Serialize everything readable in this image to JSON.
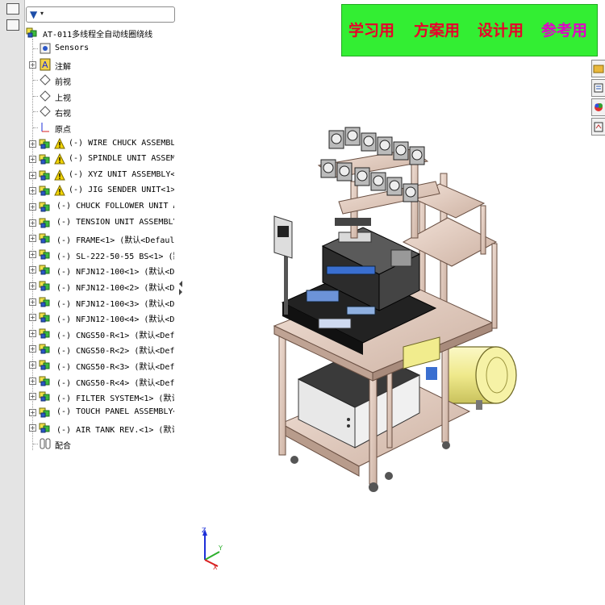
{
  "filter": {
    "icon": "filter-icon"
  },
  "tree": {
    "root": "AT-011多线程全自动线圈绕线",
    "items": [
      {
        "label": "Sensors",
        "icon": "sensors-icon",
        "expandable": false
      },
      {
        "label": "注解",
        "icon": "annotations-icon",
        "expandable": true
      },
      {
        "label": "前视",
        "icon": "plane-icon",
        "expandable": false
      },
      {
        "label": "上视",
        "icon": "plane-icon",
        "expandable": false
      },
      {
        "label": "右视",
        "icon": "plane-icon",
        "expandable": false
      },
      {
        "label": "原点",
        "icon": "origin-icon",
        "expandable": false
      },
      {
        "label": "(-) WIRE CHUCK ASSEMBLY",
        "icon": "assembly-warning-icon",
        "expandable": true
      },
      {
        "label": "(-) SPINDLE UNIT ASSEMB",
        "icon": "assembly-warning-icon",
        "expandable": true
      },
      {
        "label": "(-) XYZ  UNIT ASSEMBLY<",
        "icon": "assembly-warning-icon",
        "expandable": true
      },
      {
        "label": "(-) JIG SENDER UNIT<1>",
        "icon": "assembly-warning-icon",
        "expandable": true
      },
      {
        "label": "(-) CHUCK FOLLOWER UNIT AS",
        "icon": "assembly-icon",
        "expandable": true
      },
      {
        "label": "(-) TENSION UNIT ASSEMBLY",
        "icon": "assembly-icon",
        "expandable": true
      },
      {
        "label": "(-) FRAME<1> (默认<Defaul",
        "icon": "assembly-icon",
        "expandable": true
      },
      {
        "label": "(-) SL-222-50-55 BS<1> (默",
        "icon": "assembly-icon",
        "expandable": true
      },
      {
        "label": "(-) NFJN12-100<1> (默认<D",
        "icon": "assembly-icon",
        "expandable": true
      },
      {
        "label": "(-) NFJN12-100<2> (默认<D",
        "icon": "assembly-icon",
        "expandable": true
      },
      {
        "label": "(-) NFJN12-100<3> (默认<D",
        "icon": "assembly-icon",
        "expandable": true
      },
      {
        "label": "(-) NFJN12-100<4> (默认<D",
        "icon": "assembly-icon",
        "expandable": true
      },
      {
        "label": "(-) CNGS50-R<1> (默认<Def",
        "icon": "assembly-icon",
        "expandable": true
      },
      {
        "label": "(-) CNGS50-R<2> (默认<Def",
        "icon": "assembly-icon",
        "expandable": true
      },
      {
        "label": "(-) CNGS50-R<3> (默认<Def",
        "icon": "assembly-icon",
        "expandable": true
      },
      {
        "label": "(-) CNGS50-R<4> (默认<Def",
        "icon": "assembly-icon",
        "expandable": true
      },
      {
        "label": "(-) FILTER SYSTEM<1> (默认",
        "icon": "assembly-icon",
        "expandable": true
      },
      {
        "label": "(-) TOUCH PANEL ASSEMBLY<",
        "icon": "assembly-icon",
        "expandable": true
      },
      {
        "label": "(-) AIR TANK REV.<1> (默认",
        "icon": "assembly-icon",
        "expandable": true
      },
      {
        "label": "配合",
        "icon": "mates-icon",
        "expandable": false
      }
    ]
  },
  "banner": {
    "items": [
      {
        "text": "学习用",
        "color": "#e8002a"
      },
      {
        "text": "方案用",
        "color": "#e8002a"
      },
      {
        "text": "设计用",
        "color": "#e8002a"
      },
      {
        "text": "参考用",
        "color": "#e000c8"
      }
    ],
    "background": "#33ee33"
  },
  "triad": {
    "x": "X",
    "y": "Y",
    "z": "Z"
  },
  "colors": {
    "frame": "#e6cfc3",
    "tank": "#f2ef9a",
    "machine_dark": "#2a2a2a",
    "panel_blue": "#3a6fd0"
  }
}
